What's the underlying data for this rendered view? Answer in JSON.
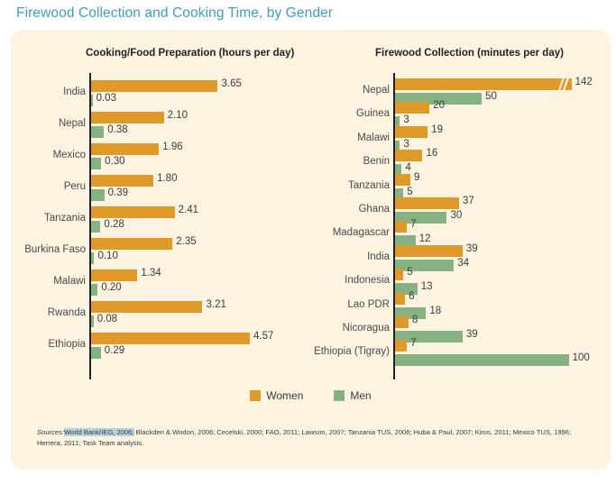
{
  "title": "Firewood Collection and Cooking Time, by Gender",
  "panels": {
    "left_heading": "Cooking/Food Preparation (hours per day)",
    "right_heading": "Firewood Collection (minutes per day)"
  },
  "legend": {
    "position": "bottom-center",
    "items": [
      {
        "label": "Women",
        "color": "#e09a2a"
      },
      {
        "label": "Men",
        "color": "#86b283"
      }
    ]
  },
  "sources": {
    "label": "Sources:",
    "highlighted": "World Bank/IEG, 2006;",
    "rest": " Blackden & Wodon, 2006; Cecelski, 2000; FAO, 2011; Lawson, 2007; Tanzania TUS, 2006; Huba & Paul, 2007; Kiros, 2011; Mexico TUS, 1996; Herrera, 2011; Task Team analysis."
  },
  "colors": {
    "title": "#3d9cc9",
    "panel_background": "#fdf3e1",
    "women": "#e09a2a",
    "men": "#86b283",
    "axis": "#231f20",
    "text": "#3b3b3b"
  },
  "chart_data": [
    {
      "type": "bar",
      "orientation": "horizontal",
      "title": "Cooking/Food Preparation (hours per day)",
      "xlabel": "hours per day",
      "ylabel": "",
      "grid": false,
      "xlim": [
        0,
        4.57
      ],
      "axis_break": false,
      "categories": [
        "India",
        "Nepal",
        "Mexico",
        "Peru",
        "Tanzania",
        "Burkina Faso",
        "Malawi",
        "Rwanda",
        "Ethiopia"
      ],
      "series": [
        {
          "name": "Women",
          "color": "#e09a2a",
          "values": [
            3.65,
            2.1,
            1.96,
            1.8,
            2.41,
            2.35,
            1.34,
            3.21,
            4.57
          ],
          "labels": [
            "3.65",
            "2.10",
            "1.96",
            "1.80",
            "2.41",
            "2.35",
            "1.34",
            "3.21",
            "4.57"
          ]
        },
        {
          "name": "Men",
          "color": "#86b283",
          "values": [
            0.03,
            0.38,
            0.3,
            0.39,
            0.28,
            0.1,
            0.2,
            0.08,
            0.29
          ],
          "labels": [
            "0.03",
            "0.38",
            "0.30",
            "0.39",
            "0.28",
            "0.10",
            "0.20",
            "0.08",
            "0.29"
          ]
        }
      ]
    },
    {
      "type": "bar",
      "orientation": "horizontal",
      "title": "Firewood Collection (minutes per day)",
      "xlabel": "minutes per day",
      "ylabel": "",
      "grid": false,
      "xlim": [
        0,
        100
      ],
      "axis_break": true,
      "axis_break_note": "Nepal women bar (142) is truncated and marked with a double-slash break",
      "categories": [
        "Nepal",
        "Guinea",
        "Malawi",
        "Benin",
        "Tanzania",
        "Ghana",
        "Madagascar",
        "India",
        "Indonesia",
        "Lao PDR",
        "Nicoragua",
        "Ethiopia (Tigray)"
      ],
      "series": [
        {
          "name": "Women",
          "color": "#e09a2a",
          "values": [
            142,
            20,
            19,
            16,
            9,
            37,
            7,
            39,
            5,
            6,
            8,
            7
          ],
          "labels": [
            "142",
            "20",
            "19",
            "16",
            "9",
            "37",
            "7",
            "39",
            "5",
            "6",
            "8",
            "7"
          ]
        },
        {
          "name": "Men",
          "color": "#86b283",
          "values": [
            50,
            3,
            3,
            4,
            5,
            30,
            12,
            34,
            13,
            18,
            39,
            100
          ],
          "labels": [
            "50",
            "3",
            "3",
            "4",
            "5",
            "30",
            "12",
            "34",
            "13",
            "18",
            "39",
            "100"
          ]
        }
      ]
    }
  ]
}
